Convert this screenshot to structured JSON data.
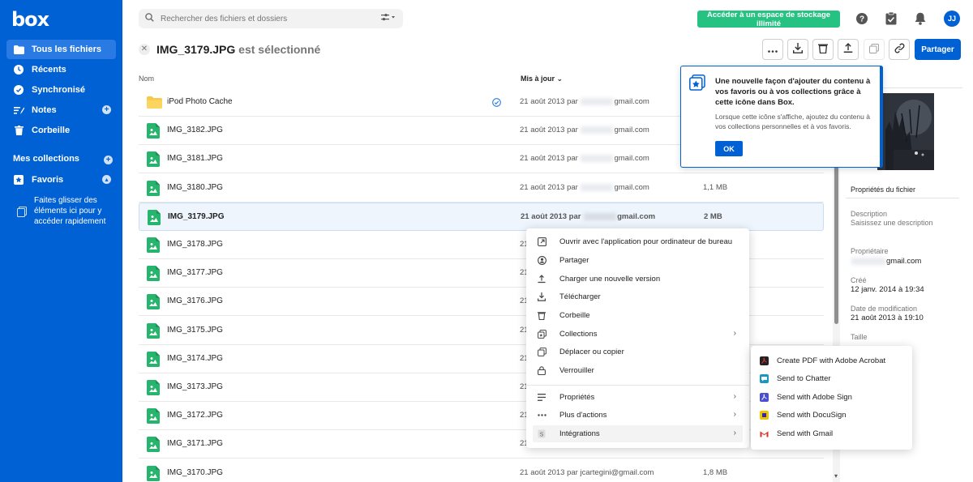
{
  "brand": {
    "logo": "box",
    "color": "#0061d5"
  },
  "sidebar": {
    "items": [
      {
        "label": "Tous les fichiers",
        "icon": "folder-icon"
      },
      {
        "label": "Récents",
        "icon": "clock-icon"
      },
      {
        "label": "Synchronisé",
        "icon": "sync-icon"
      },
      {
        "label": "Notes",
        "icon": "notes-icon"
      },
      {
        "label": "Corbeille",
        "icon": "trash-icon"
      }
    ],
    "collections_heading": "Mes collections",
    "favorites_label": "Favoris",
    "drag_hint": "Faites glisser des éléments ici pour y accéder rapidement"
  },
  "header": {
    "search_placeholder": "Rechercher des fichiers et dossiers",
    "upgrade_label": "Accéder à un espace de stockage illimité",
    "avatar_initials": "JJ"
  },
  "selection": {
    "filename": "IMG_3179.JPG",
    "suffix": "est sélectionné",
    "share_label": "Partager"
  },
  "columns": {
    "name": "Nom",
    "updated": "Mis à jour"
  },
  "files": [
    {
      "name": "iPod Photo Cache",
      "type": "folder",
      "date_prefix": "21 août 2013 par",
      "email_suffix": "gmail.com",
      "size": "",
      "synced": true
    },
    {
      "name": "IMG_3182.JPG",
      "type": "image",
      "date_prefix": "21 août 2013 par",
      "email_suffix": "gmail.com",
      "size": ""
    },
    {
      "name": "IMG_3181.JPG",
      "type": "image",
      "date_prefix": "21 août 2013 par",
      "email_suffix": "gmail.com",
      "size": ""
    },
    {
      "name": "IMG_3180.JPG",
      "type": "image",
      "date_prefix": "21 août 2013 par",
      "email_suffix": "gmail.com",
      "size": "1,1 MB"
    },
    {
      "name": "IMG_3179.JPG",
      "type": "image",
      "date_prefix": "21 août 2013 par",
      "email_suffix": "gmail.com",
      "size": "2 MB",
      "selected": true
    },
    {
      "name": "IMG_3178.JPG",
      "type": "image",
      "date_prefix": "21",
      "email_suffix": "",
      "size": ""
    },
    {
      "name": "IMG_3177.JPG",
      "type": "image",
      "date_prefix": "21",
      "email_suffix": "",
      "size": ""
    },
    {
      "name": "IMG_3176.JPG",
      "type": "image",
      "date_prefix": "21",
      "email_suffix": "",
      "size": ""
    },
    {
      "name": "IMG_3175.JPG",
      "type": "image",
      "date_prefix": "21",
      "email_suffix": "",
      "size": ""
    },
    {
      "name": "IMG_3174.JPG",
      "type": "image",
      "date_prefix": "21",
      "email_suffix": "",
      "size": ""
    },
    {
      "name": "IMG_3173.JPG",
      "type": "image",
      "date_prefix": "21",
      "email_suffix": "",
      "size": ""
    },
    {
      "name": "IMG_3172.JPG",
      "type": "image",
      "date_prefix": "21",
      "email_suffix": "",
      "size": ""
    },
    {
      "name": "IMG_3171.JPG",
      "type": "image",
      "date_prefix": "21",
      "email_suffix": "",
      "size": ""
    },
    {
      "name": "IMG_3170.JPG",
      "type": "image",
      "date_prefix": "21 août 2013 par jcartegini@gmail.com",
      "email_suffix": "",
      "size": "1,8 MB",
      "full": true
    }
  ],
  "tooltip": {
    "title": "Une nouvelle façon d'ajouter du contenu à vos favoris ou à vos collections grâce à cette icône dans Box.",
    "body": "Lorsque cette icône s'affiche, ajoutez du contenu à vos collections personnelles et à vos favoris.",
    "ok_label": "OK"
  },
  "details": {
    "heading": "Propriétés du fichier",
    "description_label": "Description",
    "description_placeholder": "Saisissez une description",
    "owner_label": "Propriétaire",
    "owner_suffix": "gmail.com",
    "created_label": "Créé",
    "created_value": "12 janv. 2014 à 19:34",
    "modified_label": "Date de modification",
    "modified_value": "21 août 2013 à 19:10",
    "size_label": "Taille"
  },
  "context_menu": {
    "items": [
      {
        "label": "Ouvrir avec l'application pour ordinateur de bureau"
      },
      {
        "label": "Partager"
      },
      {
        "label": "Charger une nouvelle version"
      },
      {
        "label": "Télécharger"
      },
      {
        "label": "Corbeille"
      },
      {
        "label": "Collections"
      },
      {
        "label": "Déplacer ou copier"
      },
      {
        "label": "Verrouiller"
      },
      {
        "label": "Propriétés"
      },
      {
        "label": "Plus d'actions"
      },
      {
        "label": "Intégrations"
      }
    ]
  },
  "submenu": {
    "items": [
      {
        "label": "Create PDF with Adobe Acrobat",
        "color": "#222222"
      },
      {
        "label": "Send to Chatter",
        "color": "#1798c1"
      },
      {
        "label": "Send with Adobe Sign",
        "color": "#4a4fd1"
      },
      {
        "label": "Send with DocuSign",
        "color": "#f2c200"
      },
      {
        "label": "Send with Gmail",
        "color": "#d93025"
      }
    ]
  }
}
